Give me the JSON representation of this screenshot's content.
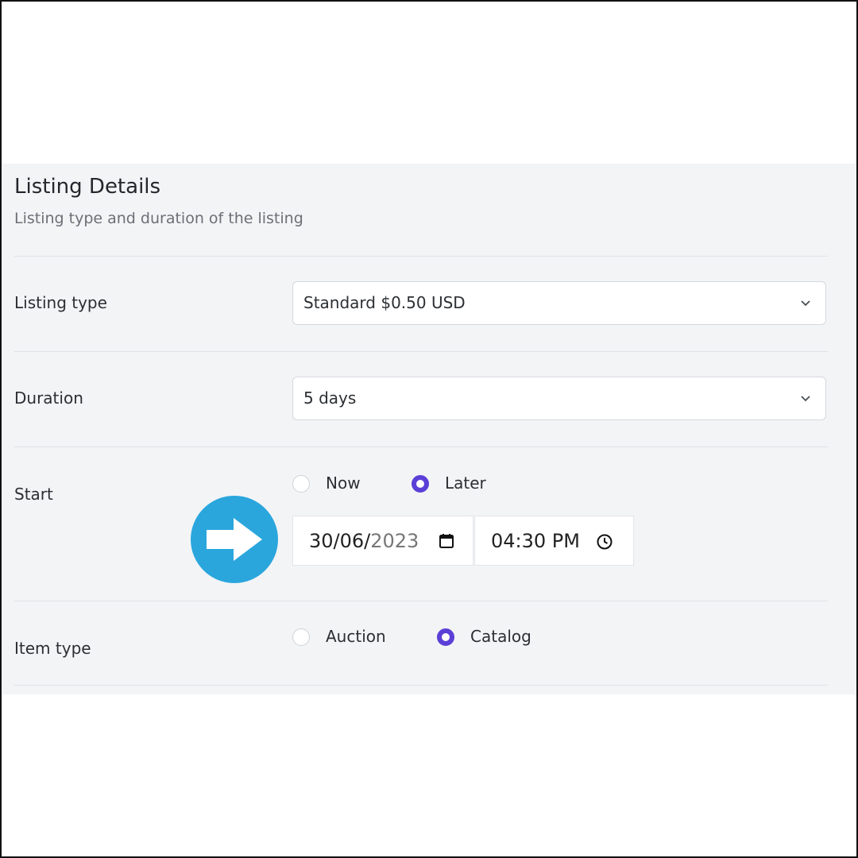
{
  "section": {
    "title": "Listing Details",
    "subtitle": "Listing type and duration of the listing"
  },
  "listing_type": {
    "label": "Listing type",
    "value": "Standard $0.50 USD"
  },
  "duration": {
    "label": "Duration",
    "value": "5 days"
  },
  "start": {
    "label": "Start",
    "options": [
      {
        "label": "Now",
        "checked": false
      },
      {
        "label": "Later",
        "checked": true
      }
    ],
    "date_day_month": "30/06/",
    "date_year": "2023",
    "time": "04:30 PM"
  },
  "item_type": {
    "label": "Item type",
    "options": [
      {
        "label": "Auction",
        "checked": false
      },
      {
        "label": "Catalog",
        "checked": true
      }
    ]
  },
  "colors": {
    "accent": "#5b3fd6",
    "arrow_badge": "#2aa6dd",
    "panel_bg": "#f3f4f6"
  },
  "icons": [
    "chevron-down-icon",
    "calendar-icon",
    "clock-icon",
    "arrow-right-icon"
  ]
}
